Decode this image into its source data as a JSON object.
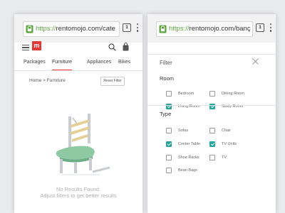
{
  "left_screen": {
    "browser": {
      "url_scheme": "https://",
      "url_rest": "rentomojo.com/cate",
      "tab_count": "1"
    },
    "header": {
      "logo_text": "m"
    },
    "tabs": [
      {
        "label": "Packages",
        "active": false
      },
      {
        "label": "Furniture",
        "active": true
      },
      {
        "label": "Appliances",
        "active": false
      },
      {
        "label": "Bikes",
        "active": false
      }
    ],
    "breadcrumb": "Home > Furniture",
    "reset_button": "Reset Filter",
    "empty_state": {
      "line1": "No Results Found.",
      "line2": "Adjust filters to get better results"
    }
  },
  "right_screen": {
    "browser": {
      "url_scheme": "https://",
      "url_rest": "rentomojo.com/banç",
      "tab_count": "1"
    },
    "filter_title": "Filter",
    "room": {
      "label": "Room",
      "options": [
        {
          "label": "Bedroom",
          "checked": false
        },
        {
          "label": "Dining Room",
          "checked": false
        },
        {
          "label": "Living Room",
          "checked": true
        },
        {
          "label": "Study Room",
          "checked": true
        }
      ]
    },
    "type": {
      "label": "Type",
      "options": [
        {
          "label": "Sofas",
          "checked": false
        },
        {
          "label": "Chair",
          "checked": false
        },
        {
          "label": "Center Table",
          "checked": true
        },
        {
          "label": "TV Units",
          "checked": true
        },
        {
          "label": "Shoe Racks",
          "checked": false
        },
        {
          "label": "TV",
          "checked": false
        },
        {
          "label": "Bean Bags",
          "checked": false
        }
      ]
    }
  },
  "colors": {
    "accent_red": "#e53935",
    "check_teal": "#26a69a",
    "https_green": "#5aa33d",
    "chair_seat": "#8fc9a3"
  },
  "icons": [
    "lock-icon",
    "menu-icon",
    "search-icon",
    "cart-icon",
    "close-icon",
    "more-vert-icon"
  ]
}
